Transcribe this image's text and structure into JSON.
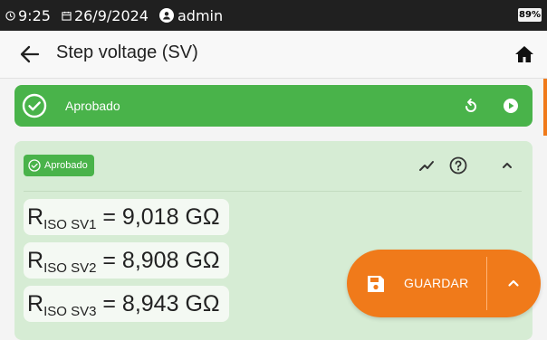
{
  "status_bar": {
    "time": "9:25",
    "date": "26/9/2024",
    "user": "admin",
    "battery": "89%",
    "icons": [
      "clock-icon",
      "calendar-icon",
      "user-icon",
      "battery-icon"
    ]
  },
  "header": {
    "title": "Step voltage (SV)",
    "icons": [
      "arrow-left-icon",
      "home-icon"
    ]
  },
  "banner": {
    "status": "Aprobado",
    "color": "#49b34a",
    "icons": [
      "check-circle-icon",
      "reload-icon",
      "play-icon"
    ]
  },
  "card": {
    "chip_label": "Aprobado",
    "background": "#d6ecd4",
    "icons": [
      "chart-line-icon",
      "help-circle-icon",
      "chevron-up-icon"
    ],
    "results": [
      {
        "symbol": "R",
        "sub": "ISO SV1",
        "eq": " = ",
        "value": "9,018",
        "unit": "GΩ"
      },
      {
        "symbol": "R",
        "sub": "ISO SV2",
        "eq": " = ",
        "value": "8,908",
        "unit": "GΩ"
      },
      {
        "symbol": "R",
        "sub": "ISO SV3",
        "eq": " = ",
        "value": "8,943",
        "unit": "GΩ"
      }
    ]
  },
  "fab": {
    "save_label": "GUARDAR",
    "color": "#f07a1a",
    "icons": [
      "save-icon",
      "chevron-up-icon"
    ]
  }
}
